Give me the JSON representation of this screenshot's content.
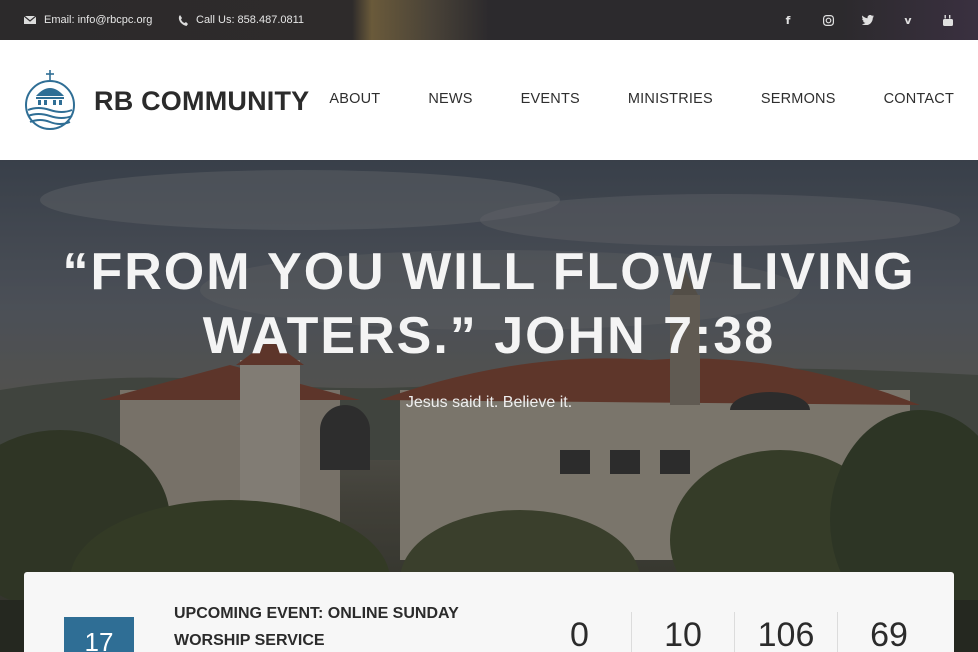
{
  "topbar": {
    "email": "Email: info@rbcpc.org",
    "phone": "Call Us: 858.487.0811",
    "socials": [
      {
        "name": "facebook-icon",
        "glyph": "f"
      },
      {
        "name": "instagram-icon",
        "glyph": "◎"
      },
      {
        "name": "twitter-icon",
        "glyph": "🐦"
      },
      {
        "name": "vimeo-icon",
        "glyph": "v"
      },
      {
        "name": "youtube-icon",
        "glyph": "▶"
      }
    ]
  },
  "header": {
    "brand": "RB COMMUNITY",
    "nav": [
      "ABOUT",
      "NEWS",
      "EVENTS",
      "MINISTRIES",
      "SERMONS",
      "CONTACT"
    ]
  },
  "hero": {
    "title": "“FROM YOU WILL FLOW LIVING WATERS.” JOHN 7:38",
    "subtitle": "Jesus said it. Believe it."
  },
  "event": {
    "day": "17",
    "title": "UPCOMING EVENT: ONLINE SUNDAY WORSHIP SERVICE",
    "countdown": [
      "0",
      "10",
      "106",
      "69"
    ]
  },
  "colors": {
    "accent": "#2f6e95",
    "topbar": "#2c2a2b",
    "text": "#2b2b2b"
  }
}
